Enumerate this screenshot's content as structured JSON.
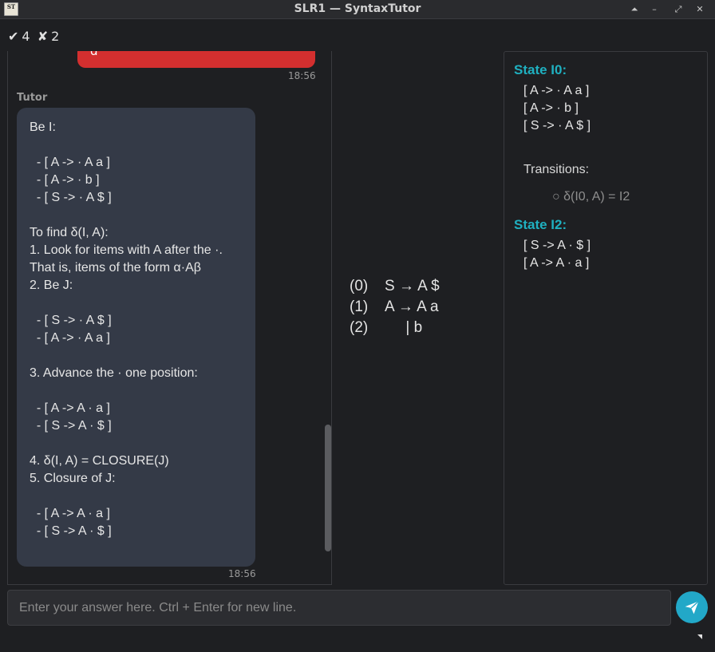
{
  "window": {
    "title": "SLR1 — SyntaxTutor",
    "icon_text": "ST",
    "buttons": [
      "⏶",
      "–",
      "⤢",
      "✕"
    ]
  },
  "score": {
    "correct_symbol": "✔",
    "correct": "4",
    "wrong_symbol": "✘",
    "wrong": "2"
  },
  "chat": {
    "user_message": {
      "text": "d",
      "time": "18:56"
    },
    "tutor": {
      "sender": "Tutor",
      "time": "18:56",
      "lines": [
        "Be I:",
        "",
        "  - [ A -> · A a ]",
        "  - [ A -> · b ]",
        "  - [ S -> · A $ ]",
        "",
        "To find δ(I, A):",
        "1. Look for items with A after the ·.",
        "That is, items of the form α·Aβ",
        "2. Be J:",
        "",
        "  - [ S -> · A $ ]",
        "  - [ A -> · A a ]",
        "",
        "3. Advance the · one position:",
        "",
        "  - [ A -> A · a ]",
        "  - [ S -> A · $ ]",
        "",
        "4. δ(I, A) = CLOSURE(J)",
        "5. Closure of J:",
        "",
        "  - [ A -> A · a ]",
        "  - [ S -> A · $ ]"
      ]
    }
  },
  "grammar": [
    {
      "num": "(0)",
      "rule": "S → A $"
    },
    {
      "num": "(1)",
      "rule": "A → A a"
    },
    {
      "num": "(2)",
      "rule": "     | b"
    }
  ],
  "states": {
    "i0": {
      "title": "State I0:",
      "items": [
        "[ A -> · A a ]",
        "[ A -> · b ]",
        "[ S -> · A $ ]"
      ]
    },
    "transitions_label": "Transitions:",
    "transitions": [
      "○ δ(I0, A) = I2"
    ],
    "i2": {
      "title": "State I2:",
      "items": [
        "[ S -> A · $ ]",
        "[ A -> A · a ]"
      ]
    }
  },
  "input": {
    "placeholder": "Enter your answer here. Ctrl + Enter for new line.",
    "value": ""
  },
  "colors": {
    "accent": "#1fb0c0",
    "send": "#22a8c8",
    "error": "#d32f2f",
    "bubble": "#343a47"
  }
}
